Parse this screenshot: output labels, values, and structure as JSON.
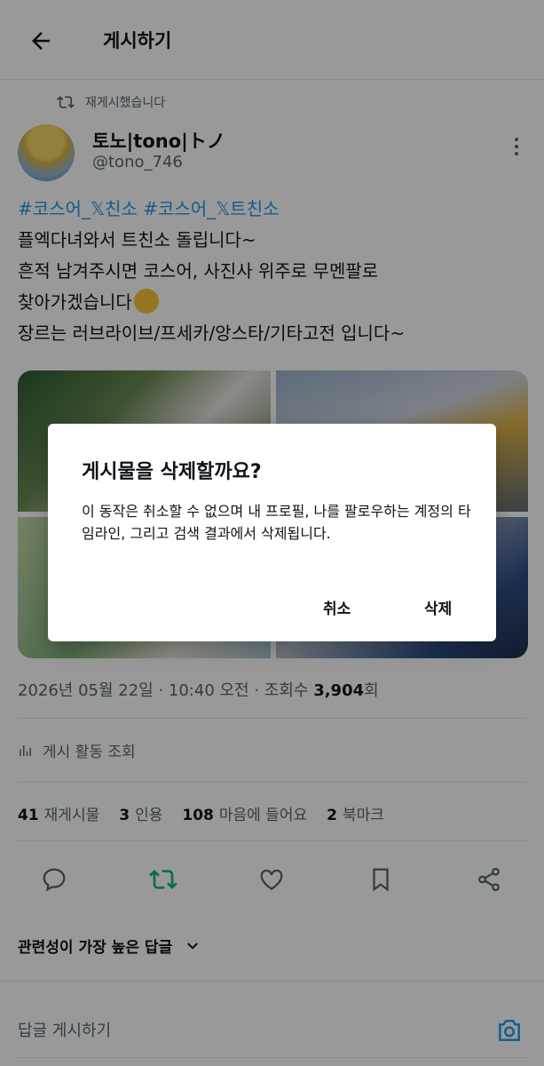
{
  "header": {
    "title": "게시하기"
  },
  "repost_notice": "재게시했습니다",
  "author": {
    "name": "토노|tono|トノ",
    "handle": "@tono_746"
  },
  "tweet": {
    "hashtag1": "#코스어_𝕏친소",
    "hashtag2": "#코스어_𝕏트친소",
    "line1": "플엑다녀와서 트친소 돌립니다~",
    "line2": "흔적 남겨주시면 코스어, 사진사 위주로 무멘팔로",
    "line3": "찾아가겠습니다",
    "line4": "장르는 러브라이브/프세카/앙스타/기타고전 입니다~",
    "emoji": "hugging-face-emoji"
  },
  "meta": {
    "timestamp": "2026년 05월 22일 · 10:40 오전 · 조회수 ",
    "views": "3,904",
    "views_suffix": "회"
  },
  "activity": {
    "label": "게시 활동 조회"
  },
  "stats": [
    {
      "count": "41",
      "label": "재게시물"
    },
    {
      "count": "3",
      "label": "인용"
    },
    {
      "count": "108",
      "label": "마음에 들어요"
    },
    {
      "count": "2",
      "label": "북마크"
    }
  ],
  "replies_sort": {
    "label": "관련성이 가장 높은 답글"
  },
  "reply_bar": {
    "placeholder": "답글 게시하기"
  },
  "dialog": {
    "title": "게시물을 삭제할까요?",
    "body": "이 동작은 취소할 수 없으며 내 프로필, 나를 팔로우하는 계정의 타임라인, 그리고 검색 결과에서 삭제됩니다.",
    "cancel": "취소",
    "delete": "삭제"
  },
  "colors": {
    "accent": "#1d9bf0",
    "repost_green": "#00ba7c",
    "muted": "#536471"
  }
}
